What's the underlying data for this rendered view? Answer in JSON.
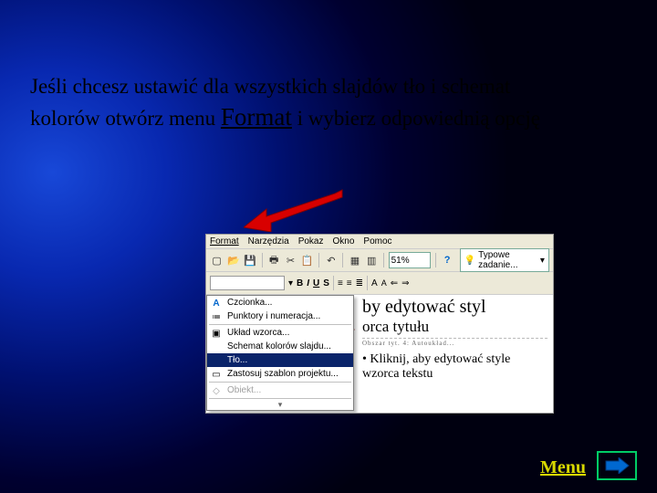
{
  "instruction": {
    "before_format": "Jeśli chcesz ustawić dla wszystkich slajdów tło i schemat kolorów  otwórz menu ",
    "format": "Format",
    "after_format": " i wybierz odpowiednią opcję"
  },
  "menubar": {
    "items": [
      "Format",
      "Narzędzia",
      "Pokaz",
      "Okno",
      "Pomoc"
    ]
  },
  "toolbar": {
    "zoom": "51%",
    "task_label": "Typowe zadanie..."
  },
  "dropdown": {
    "font": "Czcionka...",
    "bullets": "Punktory i numeracja...",
    "layout": "Układ wzorca...",
    "color_scheme": "Schemat kolorów slajdu...",
    "background": "Tło...",
    "apply_template": "Zastosuj szablon projektu...",
    "object": "Obiekt..."
  },
  "slide_editor": {
    "title_visible": "by edytować styl",
    "subtitle_visible": "orca tytułu",
    "bullet": "Kliknij, aby edytować style wzorca tekstu",
    "ruler_right": "Obszar tyt. 4: Autoukład..."
  },
  "nav": {
    "menu": "Menu"
  }
}
